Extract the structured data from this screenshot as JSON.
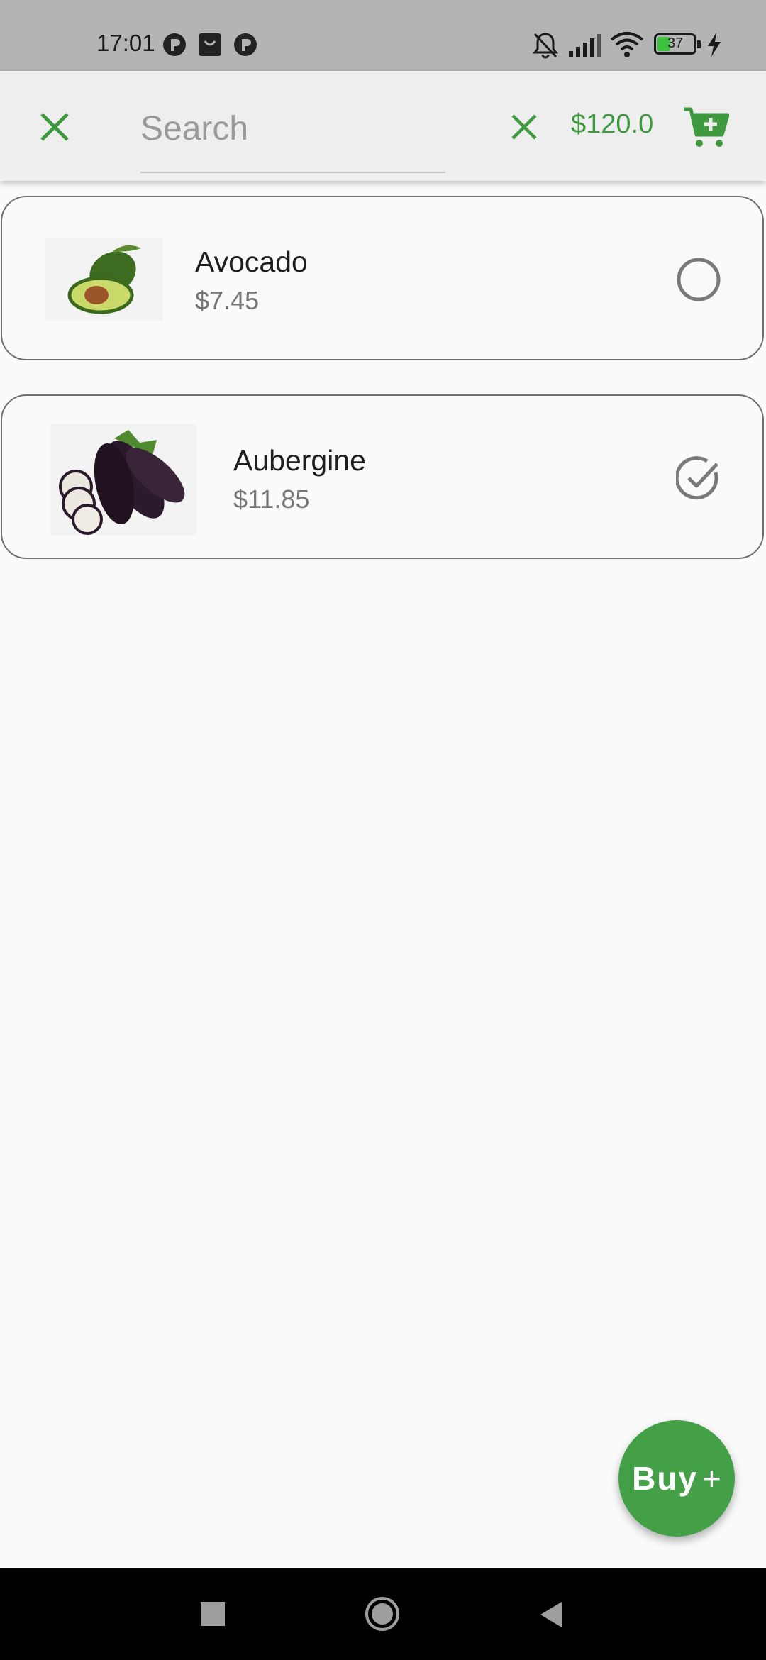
{
  "status_bar": {
    "time": "17:01",
    "battery_level": "37",
    "app_icons": [
      "p-circle-icon",
      "bag-icon",
      "p-circle-icon"
    ],
    "indicators": [
      "bell-off-icon",
      "signal-icon",
      "wifi-icon",
      "battery-icon",
      "charging-icon"
    ]
  },
  "app_bar": {
    "search": {
      "value": "",
      "placeholder": "Search"
    },
    "balance": "$120.0",
    "accent_color": "#3f9a3f"
  },
  "items": [
    {
      "name": "Avocado",
      "price": "$7.45",
      "selected": false,
      "image": "avocado"
    },
    {
      "name": "Aubergine",
      "price": "$11.85",
      "selected": true,
      "image": "aubergine"
    }
  ],
  "fab": {
    "label": "Buy",
    "icon": "+",
    "color": "#43a047"
  }
}
